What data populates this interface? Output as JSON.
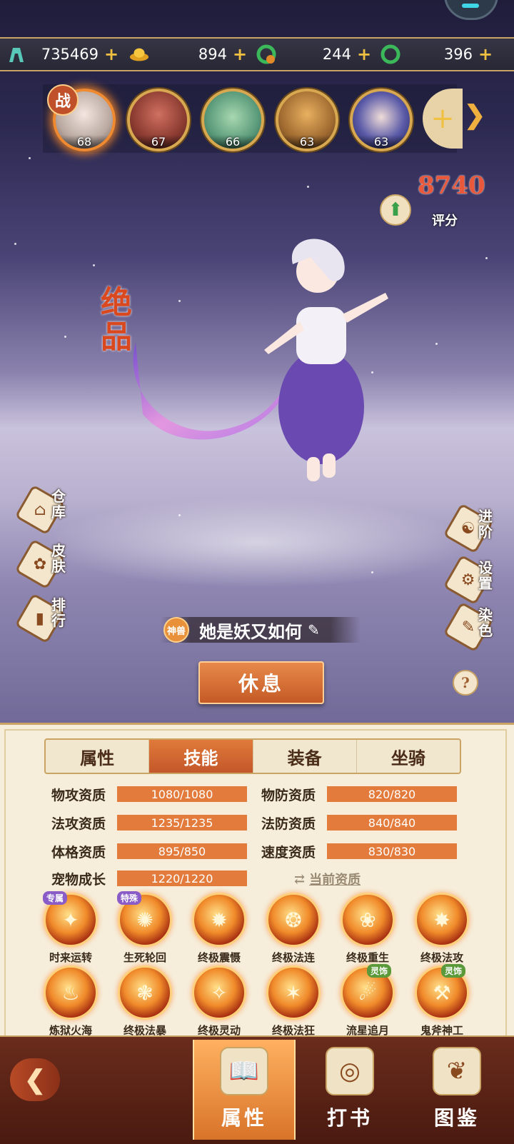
{
  "resources": [
    {
      "icon": "tower-icon",
      "value": "735469"
    },
    {
      "icon": "gold-ingot-icon",
      "value": "894"
    },
    {
      "icon": "bound-jade-icon",
      "value": "244"
    },
    {
      "icon": "jade-ring-icon",
      "value": "396"
    }
  ],
  "pets": [
    {
      "level": "68",
      "badge": "战"
    },
    {
      "level": "67"
    },
    {
      "level": "66"
    },
    {
      "level": "63"
    },
    {
      "level": "63"
    }
  ],
  "score": {
    "value": "8740",
    "label": "评分"
  },
  "rank": "绝品",
  "side_left": [
    {
      "label": "仓库",
      "icon": "house-icon"
    },
    {
      "label": "皮肤",
      "icon": "paw-icon"
    },
    {
      "label": "排行",
      "icon": "bar-chart-icon"
    }
  ],
  "side_right": [
    {
      "label": "进阶",
      "icon": "yin-yang-icon"
    },
    {
      "label": "设置",
      "icon": "gear-icon"
    },
    {
      "label": "染色",
      "icon": "palette-icon"
    }
  ],
  "pet_tag": "神兽",
  "pet_name": "她是妖又如何",
  "rest_button": "休息",
  "tabs": [
    "属性",
    "技能",
    "装备",
    "坐骑"
  ],
  "stats": [
    {
      "label": "物攻资质",
      "value": "1080/1080"
    },
    {
      "label": "物防资质",
      "value": "820/820"
    },
    {
      "label": "法攻资质",
      "value": "1235/1235"
    },
    {
      "label": "法防资质",
      "value": "840/840"
    },
    {
      "label": "体格资质",
      "value": "895/850"
    },
    {
      "label": "速度资质",
      "value": "830/830"
    },
    {
      "label": "宠物成长",
      "value": "1220/1220"
    }
  ],
  "current_quality": "当前资质",
  "skills": [
    {
      "name": "时来运转",
      "badge": "专属"
    },
    {
      "name": "生死轮回",
      "badge": "特殊"
    },
    {
      "name": "终极震慑"
    },
    {
      "name": "终极法连"
    },
    {
      "name": "终极重生"
    },
    {
      "name": "终极法攻"
    },
    {
      "name": "炼狱火海"
    },
    {
      "name": "终极法暴"
    },
    {
      "name": "终极灵动"
    },
    {
      "name": "终极法狂"
    },
    {
      "name": "流星追月",
      "badge": "灵饰"
    },
    {
      "name": "鬼斧神工",
      "badge": "灵饰"
    }
  ],
  "bottom_nav": [
    "属性",
    "打书",
    "图鉴"
  ]
}
